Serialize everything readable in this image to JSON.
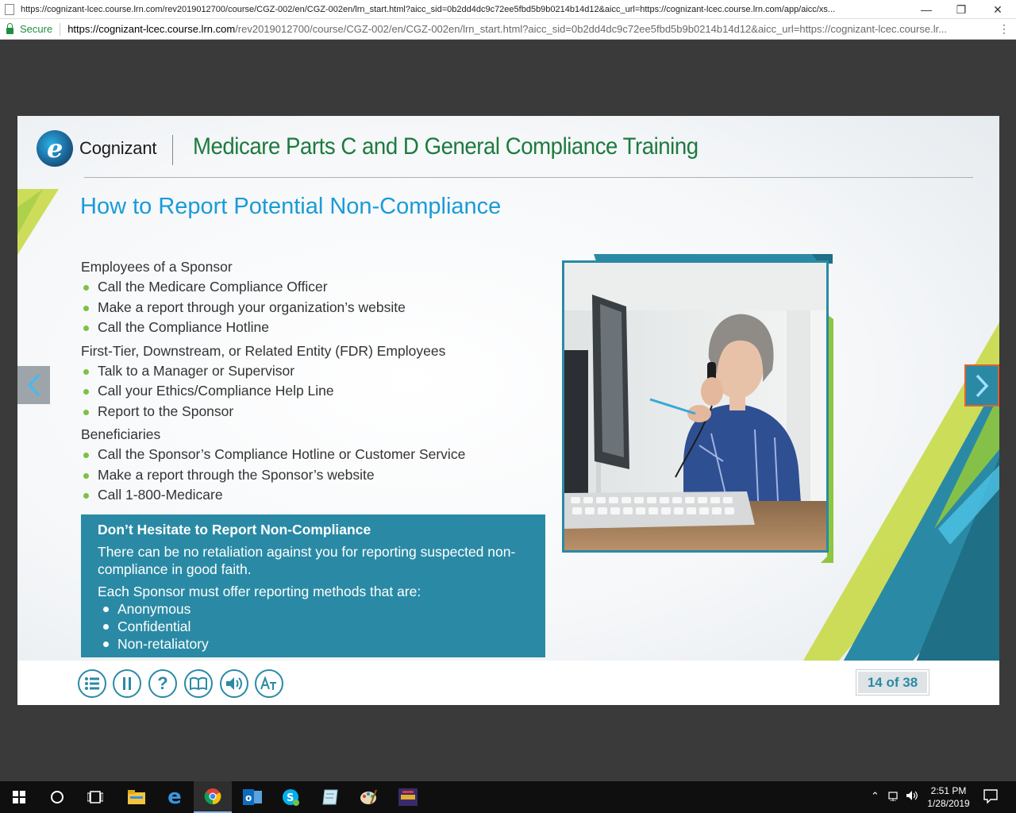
{
  "browser": {
    "window_title": "https://cognizant-lcec.course.lrn.com/rev2019012700/course/CGZ-002/en/CGZ-002en/lrn_start.html?aicc_sid=0b2dd4dc9c72ee5fbd5b9b0214b14d12&aicc_url=https://cognizant-lcec.course.lrn.com/app/aicc/xs...",
    "secure_label": "Secure",
    "url_host": "https://cognizant-lcec.course.lrn.com",
    "url_path": "/rev2019012700/course/CGZ-002/en/CGZ-002en/lrn_start.html?aicc_sid=0b2dd4dc9c72ee5fbd5b9b0214b14d12&aicc_url=https://cognizant-lcec.course.lr..."
  },
  "slide": {
    "brand": "Cognizant",
    "course_title": "Medicare Parts C and D General Compliance Training",
    "heading": "How to Report Potential Non-Compliance",
    "groups": [
      {
        "title": "Employees of a Sponsor",
        "items": [
          "Call the Medicare Compliance Officer",
          "Make a report through your organization’s website",
          "Call the Compliance Hotline"
        ]
      },
      {
        "title": "First-Tier, Downstream, or Related Entity (FDR) Employees",
        "items": [
          "Talk to a Manager or Supervisor",
          "Call your Ethics/Compliance Help Line",
          "Report to the Sponsor"
        ]
      },
      {
        "title": "Beneficiaries",
        "items": [
          "Call the Sponsor’s Compliance Hotline or Customer Service",
          "Make a report through the Sponsor’s website",
          "Call 1-800-Medicare"
        ]
      }
    ],
    "callout": {
      "title": "Don’t Hesitate to Report Non-Compliance",
      "para1": "There can be no retaliation against you for reporting suspected non-compliance in good faith.",
      "para2": "Each Sponsor must offer reporting methods that are:",
      "items": [
        "Anonymous",
        "Confidential",
        "Non-retaliatory"
      ]
    },
    "page_counter": "14 of 38"
  },
  "footer_controls": [
    {
      "name": "menu-icon"
    },
    {
      "name": "pause-icon"
    },
    {
      "name": "help-icon"
    },
    {
      "name": "book-icon"
    },
    {
      "name": "audio-icon"
    },
    {
      "name": "text-size-icon"
    }
  ],
  "taskbar": {
    "time": "2:51 PM",
    "date": "1/28/2019"
  },
  "colors": {
    "accent_teal": "#2a8aa5",
    "heading_blue": "#1a9bd8",
    "title_green": "#1d7a3e",
    "bullet_green": "#7cc242",
    "next_border_orange": "#e2622c"
  }
}
